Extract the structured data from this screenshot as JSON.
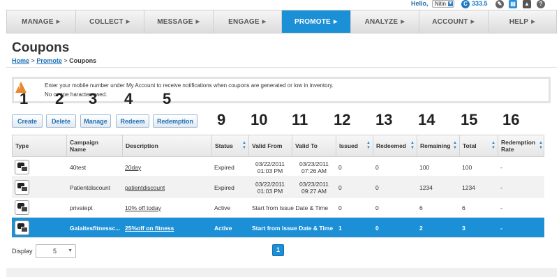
{
  "header": {
    "greeting": "Hello,",
    "user": "Nitin",
    "credit_symbol": "C",
    "credits": "333.5"
  },
  "nav": {
    "items": [
      {
        "label": "MANAGE",
        "active": false
      },
      {
        "label": "COLLECT",
        "active": false
      },
      {
        "label": "MESSAGE",
        "active": false
      },
      {
        "label": "ENGAGE",
        "active": false
      },
      {
        "label": "PROMOTE",
        "active": true
      },
      {
        "label": "ANALYZE",
        "active": false
      },
      {
        "label": "ACCOUNT",
        "active": false
      },
      {
        "label": "HELP",
        "active": false
      }
    ],
    "arrow": "▶"
  },
  "page": {
    "title": "Coupons",
    "breadcrumb": {
      "home": "Home",
      "sep1": ">",
      "promote": "Promote",
      "sep2": ">",
      "current": "Coupons"
    }
  },
  "notice": {
    "line1": "Enter your mobile number under My Account to receive notifications when coupons are generated or low in inventory.",
    "line2": "No        or spe     haracters      wed."
  },
  "toolbar": {
    "create": "Create",
    "delete": "Delete",
    "manage": "Manage",
    "redeem": "Redeem",
    "redemption": "Redemption"
  },
  "annotations": [
    "1",
    "2",
    "3",
    "4",
    "5",
    "6",
    "7",
    "8",
    "9",
    "10",
    "11",
    "12",
    "13",
    "14",
    "15",
    "16"
  ],
  "table": {
    "headers": {
      "type": "Type",
      "campaign": "Campaign Name",
      "description": "Description",
      "status": "Status",
      "valid_from": "Valid From",
      "valid_to": "Valid To",
      "issued": "Issued",
      "redeemed": "Redeemed",
      "remaining": "Remaining",
      "total": "Total",
      "redemption_rate": "Redemption Rate"
    },
    "rows": [
      {
        "campaign": "40test",
        "description": "20day",
        "status": "Expired",
        "valid_from_1": "03/22/2011",
        "valid_from_2": "01:03 PM",
        "valid_to_1": "03/23/2011",
        "valid_to_2": "07:26 AM",
        "issued": "0",
        "redeemed": "0",
        "remaining": "100",
        "total": "100",
        "rate": "-"
      },
      {
        "campaign": "Patientdiscount",
        "description": "patientdiscount",
        "status": "Expired",
        "valid_from_1": "03/22/2011",
        "valid_from_2": "01:03 PM",
        "valid_to_1": "03/23/2011",
        "valid_to_2": "09:27 AM",
        "issued": "0",
        "redeemed": "0",
        "remaining": "1234",
        "total": "1234",
        "rate": "-"
      },
      {
        "campaign": "privatept",
        "description": "10% off today",
        "status": "Active",
        "valid_range": "Start from Issue Date & Time",
        "issued": "0",
        "redeemed": "0",
        "remaining": "6",
        "total": "6",
        "rate": "-"
      },
      {
        "campaign": "Gaiaitesfitnessc...",
        "description": "25%off on fitness",
        "status": "Active",
        "valid_range": "Start from Issue Date & Time",
        "issued": "1",
        "redeemed": "0",
        "remaining": "2",
        "total": "3",
        "rate": "-"
      }
    ]
  },
  "pagination": {
    "display_label": "Display",
    "page_size": "5",
    "current_page": "1"
  }
}
